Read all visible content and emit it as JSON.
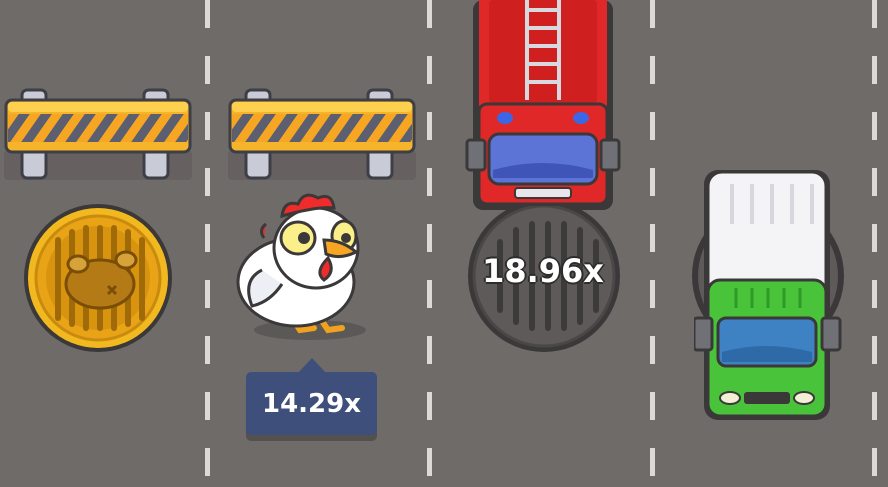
{
  "game": {
    "chicken_multiplier": "14.29x",
    "next_multiplier": "18.96x",
    "colors": {
      "road": "#6f6b69",
      "lane_marking": "#e9e6e2",
      "badge": "#3f4f7b",
      "coin": "#f1b91f",
      "barrier_stripe_orange": "#f6a623",
      "barrier_stripe_gray": "#5b5f70"
    },
    "icons": {
      "barrier": "road-barrier-icon",
      "coin": "roast-chicken-coin-icon",
      "chicken": "chicken-character-icon",
      "manhole": "manhole-cover-icon",
      "fire_truck": "fire-truck-icon",
      "delivery_truck": "green-delivery-truck-icon"
    }
  }
}
